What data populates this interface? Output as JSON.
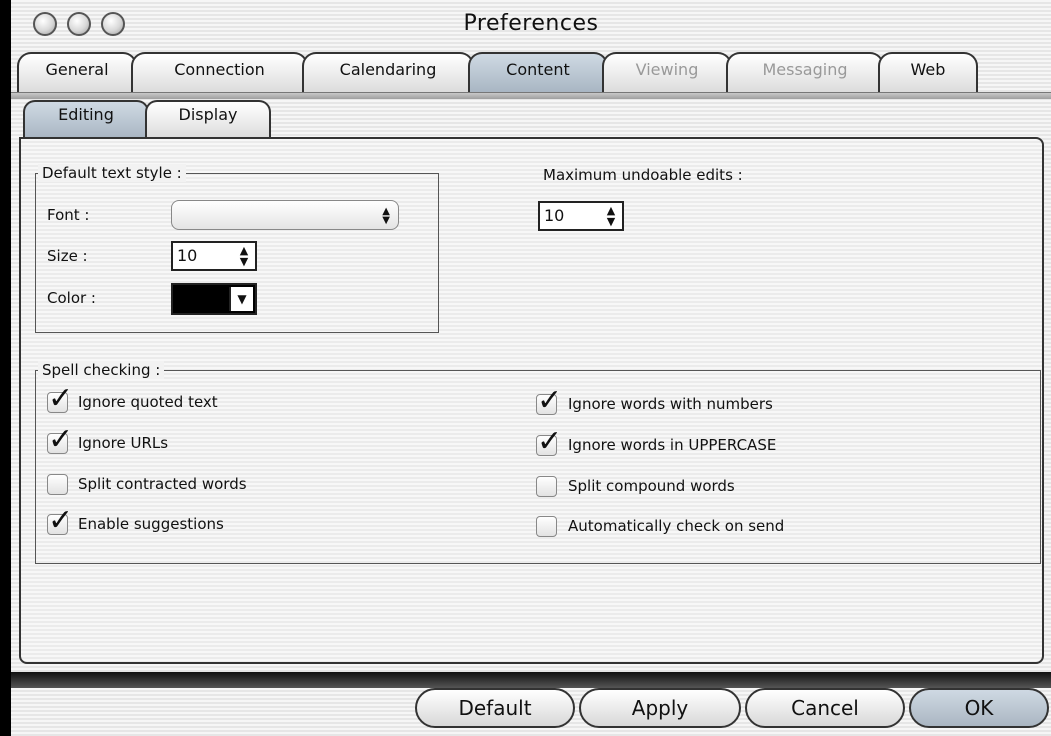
{
  "window": {
    "title": "Preferences"
  },
  "main_tabs": [
    {
      "label": "General"
    },
    {
      "label": "Connection"
    },
    {
      "label": "Calendaring"
    },
    {
      "label": "Content"
    },
    {
      "label": "Viewing"
    },
    {
      "label": "Messaging"
    },
    {
      "label": "Web"
    }
  ],
  "sub_tabs": [
    {
      "label": "Editing"
    },
    {
      "label": "Display"
    }
  ],
  "text_style": {
    "group_label": "Default text style :",
    "font_label": "Font :",
    "font_value": "",
    "size_label": "Size :",
    "size_value": "10",
    "color_label": "Color :",
    "color_value": "#000000"
  },
  "undo": {
    "label": "Maximum undoable edits :",
    "value": "10"
  },
  "spell": {
    "group_label": "Spell checking :",
    "options": [
      {
        "label": "Ignore quoted text",
        "checked": true
      },
      {
        "label": "Ignore URLs",
        "checked": true
      },
      {
        "label": "Split contracted words",
        "checked": false
      },
      {
        "label": "Enable suggestions",
        "checked": true
      },
      {
        "label": "Ignore words with numbers",
        "checked": true
      },
      {
        "label": "Ignore words in UPPERCASE",
        "checked": true
      },
      {
        "label": "Split compound words",
        "checked": false
      },
      {
        "label": "Automatically check on send",
        "checked": false
      }
    ]
  },
  "buttons": {
    "default": "Default",
    "apply": "Apply",
    "cancel": "Cancel",
    "ok": "OK"
  }
}
